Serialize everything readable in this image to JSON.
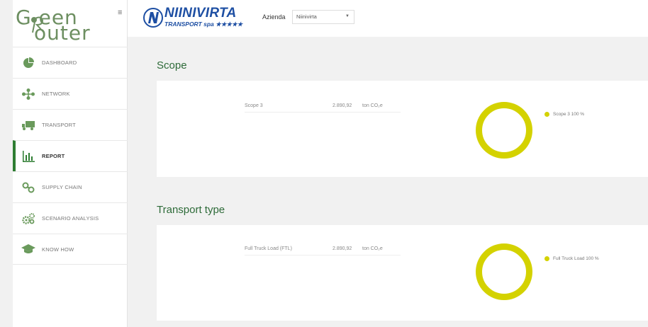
{
  "sidebar": {
    "logo_line1": "G  een",
    "logo_line2": "outer",
    "menu_icon": "hamburger-icon",
    "items": [
      {
        "label": "DASHBOARD",
        "icon": "pie-chart-icon"
      },
      {
        "label": "NETWORK",
        "icon": "network-icon"
      },
      {
        "label": "TRANSPORT",
        "icon": "truck-icon"
      },
      {
        "label": "REPORT",
        "icon": "bar-chart-icon",
        "active": true
      },
      {
        "label": "SUPPLY CHAIN",
        "icon": "chain-icon"
      },
      {
        "label": "SCENARIO ANALYSIS",
        "icon": "gears-icon"
      },
      {
        "label": "KNOW HOW",
        "icon": "graduation-cap-icon"
      }
    ]
  },
  "header": {
    "brand_name": "NIINIVIRTA",
    "brand_sub": "TRANSPORT spa ★★★★★",
    "company_label": "Azienda",
    "company_value": "Niinivirta"
  },
  "sections": [
    {
      "title": "Scope",
      "metric_name": "Scope 3",
      "metric_value": "2.890,92",
      "metric_unit": "ton CO₂e",
      "legend": "Scope 3 100 %"
    },
    {
      "title": "Transport type",
      "metric_name": "Full Truck Load (FTL)",
      "metric_value": "2.890,92",
      "metric_unit": "ton CO₂e",
      "legend": "Full Truck Load 100 %"
    }
  ],
  "colors": {
    "accent_green": "#2e6b39",
    "donut_yellow": "#d4d200",
    "brand_blue": "#1e4fa3"
  }
}
